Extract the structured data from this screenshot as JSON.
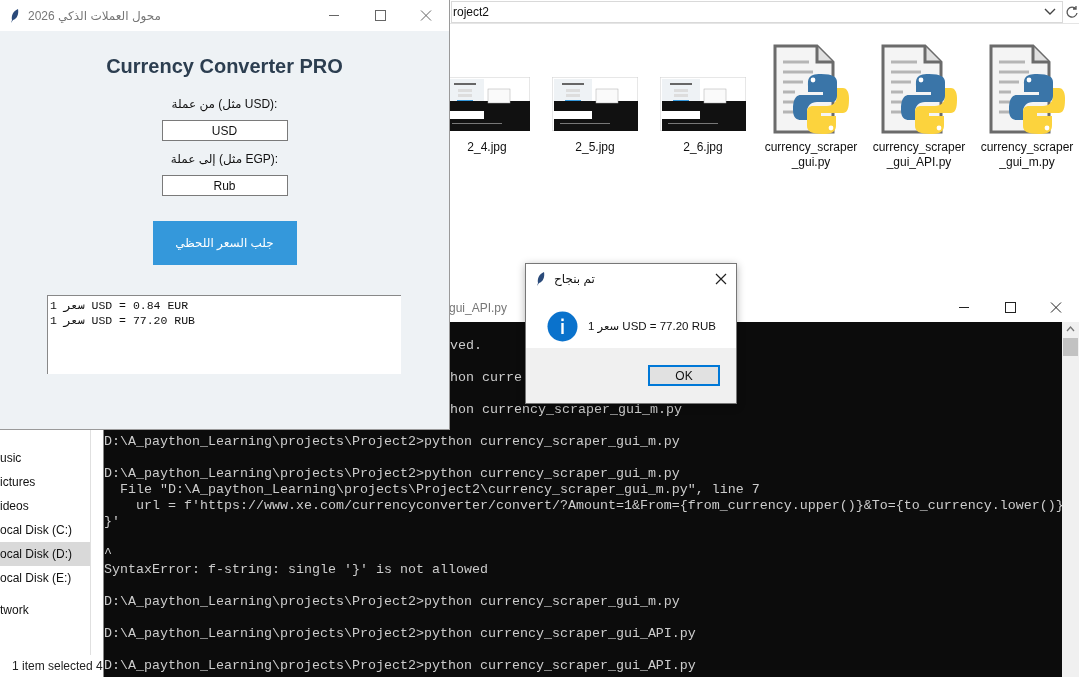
{
  "explorer": {
    "address": "roject2",
    "files": [
      {
        "name": "2_4.jpg"
      },
      {
        "name": "2_5.jpg"
      },
      {
        "name": "2_6.jpg"
      },
      {
        "kind": "script",
        "name": "currency_scraper_gui.py"
      },
      {
        "kind": "script",
        "name": "currency_scraper_gui_API.py"
      },
      {
        "kind": "script",
        "name": "currency_scraper_gui_m.py"
      }
    ],
    "sidebar": {
      "items": [
        {
          "label": "usic",
          "selected": false
        },
        {
          "label": "ictures",
          "selected": false
        },
        {
          "label": "ideos",
          "selected": false
        },
        {
          "label": "ocal Disk (C:)",
          "selected": false
        },
        {
          "label": "ocal Disk (D:)",
          "selected": true
        },
        {
          "label": "ocal Disk (E:)",
          "selected": false
        }
      ],
      "network": "twork"
    },
    "status": "1 item selected 4"
  },
  "console": {
    "title": "gui_API.py",
    "blocks": [
      {
        "kind": "tail",
        "lines": [
          "ved."
        ]
      },
      {
        "kind": "tail",
        "lines": [
          "hon curre"
        ]
      },
      {
        "kind": "tail",
        "lines": [
          "hon currency_scraper_gui_m.py"
        ]
      },
      {
        "kind": "full",
        "lines": [
          "D:\\A_paython_Learning\\projects\\Project2>python currency_scraper_gui_m.py"
        ]
      },
      {
        "kind": "full",
        "lines": [
          "D:\\A_paython_Learning\\projects\\Project2>python currency_scraper_gui_m.py",
          "  File \"D:\\A_paython_Learning\\projects\\Project2\\currency_scraper_gui_m.py\", line 7",
          "    url = f'https://www.xe.com/currencyconverter/convert/?Amount=1&From={from_currency.upper()}&To={to_currency.lower()}",
          "}'"
        ]
      },
      {
        "kind": "full",
        "lines": [
          "^",
          "SyntaxError: f-string: single '}' is not allowed"
        ]
      },
      {
        "kind": "full",
        "lines": [
          "D:\\A_paython_Learning\\projects\\Project2>python currency_scraper_gui_m.py"
        ]
      },
      {
        "kind": "full",
        "lines": [
          "D:\\A_paython_Learning\\projects\\Project2>python currency_scraper_gui_API.py"
        ]
      },
      {
        "kind": "full",
        "lines": [
          "D:\\A_paython_Learning\\projects\\Project2>python currency_scraper_gui_API.py"
        ]
      }
    ]
  },
  "app": {
    "title": "محول العملات الذكي 2026",
    "heading": "Currency Converter PRO",
    "fields": [
      {
        "label": "من عملة (مثل USD):",
        "value": "USD"
      },
      {
        "label": "إلى عملة (مثل EGP):",
        "value": "Rub"
      }
    ],
    "button": "جلب السعر اللحظي",
    "results": [
      "سعر 1 USD = 0.84 EUR",
      "سعر 1 USD = 77.20 RUB"
    ]
  },
  "dialog": {
    "title": "تم بنجاح",
    "message": "سعر 1 USD = 77.20 RUB",
    "button": "OK"
  }
}
